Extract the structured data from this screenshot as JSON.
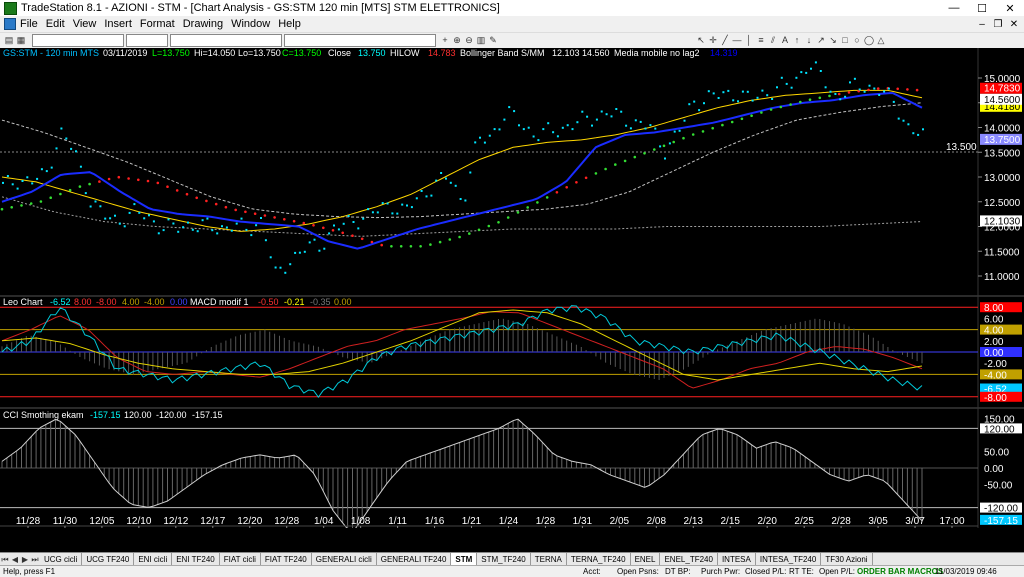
{
  "window": {
    "title": "TradeStation 8.1 - AZIONI - STM - [Chart Analysis - GS:STM  120 min  [MTS] STM ELETTRONICS]",
    "minimize": "—",
    "maximize": "☐",
    "close": "✕"
  },
  "menu": {
    "items": [
      "File",
      "Edit",
      "View",
      "Insert",
      "Format",
      "Drawing",
      "Window",
      "Help"
    ],
    "mdi": [
      "–",
      "❐",
      "✕"
    ]
  },
  "header": {
    "symbol": "GS:STM - 120 min",
    "exchange": "MTS",
    "date": "03/11/2019",
    "low_label": "L=13.750",
    "high_label": "Hi=14.050",
    "lo_label": "Lo=13.750",
    "close_label": "C=13.750",
    "close_name": "Close",
    "close_val": "13.750",
    "hilow": "HILOW",
    "hilow_val": "14.783",
    "bb_name": "Bollinger Band S/MM",
    "bb_val1": "12.103",
    "bb_val2": "14.560",
    "ma_name": "Media mobile no lag2",
    "ma_val": "14.319"
  },
  "price_axis": {
    "ticks": [
      "15.0000",
      "14.5000",
      "14.0000",
      "13.5000",
      "13.0000",
      "12.5000",
      "12.0000",
      "11.5000",
      "11.0000"
    ],
    "ref_line_label": "13.500",
    "markers": [
      {
        "label": "14.7830",
        "color": "#ff0000"
      },
      {
        "label": "14.4180",
        "color": "#ffff00"
      },
      {
        "label": "14.5600",
        "color": "#ffffff"
      },
      {
        "label": "13.7500",
        "color": "#8a8aff"
      },
      {
        "label": "12.1030",
        "color": "#ffffff"
      }
    ]
  },
  "leo_panel": {
    "name": "Leo Chart",
    "v1": "-6.52",
    "v2": "8.00",
    "v3": "-8.00",
    "v4": "4.00",
    "v5": "-4.00",
    "v6": "0.00",
    "macd_name": "MACD modif 1",
    "m1": "-0.50",
    "m2": "-0.21",
    "m3": "-0.35",
    "m4": "0.00",
    "ticks": [
      "8.00",
      "6.00",
      "4.00",
      "2.00",
      "0.00",
      "-2.00",
      "-4.00",
      "-6.52",
      "-8.00"
    ]
  },
  "cci_panel": {
    "name": "CCI Smothing ekam",
    "v1": "-157.15",
    "v2": "120.00",
    "v3": "-120.00",
    "v4": "-157.15",
    "ticks": [
      "150.00",
      "120.00",
      "50.00",
      "0.00",
      "-50.00",
      "-120.00",
      "-157.15"
    ]
  },
  "time_axis": {
    "labels": [
      "11/28",
      "11/30",
      "12/05",
      "12/10",
      "12/12",
      "12/17",
      "12/20",
      "12/28",
      "1/04",
      "1/08",
      "1/11",
      "1/16",
      "1/21",
      "1/24",
      "1/28",
      "1/31",
      "2/05",
      "2/08",
      "2/13",
      "2/15",
      "2/20",
      "2/25",
      "2/28",
      "3/05",
      "3/07",
      "17:00"
    ]
  },
  "tabs": {
    "items": [
      "UCG cicli",
      "UCG TF240",
      "ENI cicli",
      "ENI TF240",
      "FIAT cicli",
      "FIAT TF240",
      "GENERALI cicli",
      "GENERALI TF240",
      "STM",
      "STM_TF240",
      "TERNA",
      "TERNA_TF240",
      "ENEL",
      "ENEL_TF240",
      "INTESA",
      "INTESA_TF240",
      "TF30 Azioni"
    ],
    "active_index": 8
  },
  "status": {
    "help": "Help, press F1",
    "acct": "Acct:",
    "open_psns": "Open Psns:",
    "dt_bp": "DT BP:",
    "purch_pwr": "Purch Pwr:",
    "closed_pl": "Closed P/L:",
    "rt_te": "RT TE:",
    "open_pl": "Open P/L:",
    "macros": "ORDER BAR MACROS",
    "datetime": "11/03/2019 09:46"
  },
  "colors": {
    "background": "#000000",
    "price": "#00e5ff",
    "bb_mid": "#0000ff",
    "bb_upper": "#ffd700",
    "hilow_red": "#ff0000",
    "hilow_green": "#32cd32",
    "white_line": "#c0c0c0"
  }
}
